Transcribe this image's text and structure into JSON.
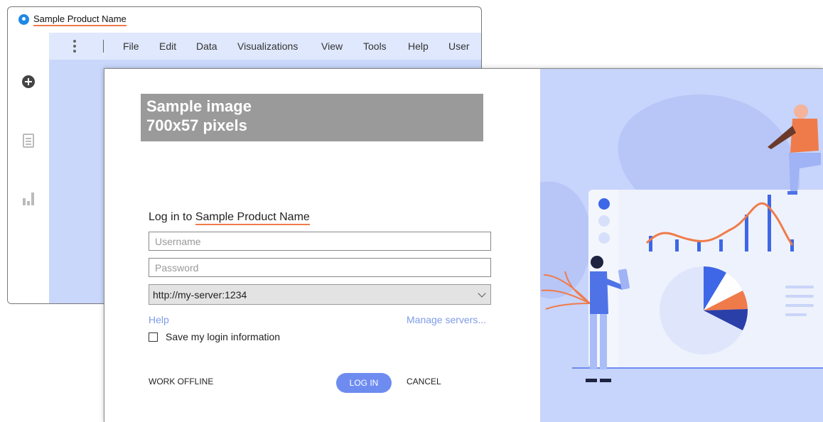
{
  "app": {
    "title": "Sample Product Name",
    "menu": [
      "File",
      "Edit",
      "Data",
      "Visualizations",
      "View",
      "Tools",
      "Help",
      "User"
    ],
    "sidebar_icons": [
      "add-icon",
      "document-icon",
      "bar-chart-icon"
    ]
  },
  "dialog": {
    "banner_line1": "Sample image",
    "banner_line2": "700x57 pixels",
    "heading_prefix": "Log in to ",
    "heading_product": "Sample Product Name",
    "username_placeholder": "Username",
    "password_placeholder": "Password",
    "server": "http://my-server:1234",
    "help_link": "Help",
    "manage_servers_link": "Manage servers...",
    "save_login_label": "Save my login information",
    "save_login_checked": false,
    "work_offline": "WORK OFFLINE",
    "log_in": "LOG IN",
    "cancel": "CANCEL"
  },
  "colors": {
    "accent": "#6e8cf0",
    "link": "#7f9be8",
    "underline": "#f07b4a",
    "illustration_bg": "#c7d4fb"
  }
}
